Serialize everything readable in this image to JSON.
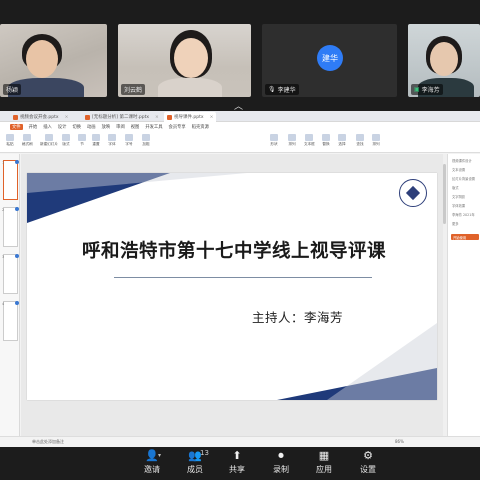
{
  "participants": [
    {
      "name": "杨颖",
      "has_mic": false
    },
    {
      "name": "刘云鹤",
      "has_mic": false
    },
    {
      "name": "李建华",
      "has_mic": true,
      "avatar_text": "建华",
      "avatar_color": "#2f7cf6"
    },
    {
      "name": "李海芳",
      "has_mic": true
    }
  ],
  "collapse_icon": "chevron-up-icon",
  "wps": {
    "tabs": [
      {
        "label": "视频会议开会.pptx"
      },
      {
        "label": "[无标题分析] 第二课时.pptx"
      },
      {
        "label": "视导课件.pptx"
      }
    ],
    "menu": [
      "文件",
      "开始",
      "插入",
      "设计",
      "切换",
      "动画",
      "放映",
      "审阅",
      "视图",
      "开发工具",
      "会员专享",
      "稻壳资源"
    ],
    "ribbon": [
      "粘贴",
      "格式刷",
      "新建幻灯片",
      "版式",
      "节",
      "重置",
      "字体",
      "字号",
      "加粗",
      "形状",
      "排列",
      "文本框",
      "替换",
      "选择",
      "查找",
      "排列"
    ],
    "right_panel": [
      "视频课件设计",
      "文本设置",
      "幻灯片背景设置",
      "版式",
      "文字阴影",
      "字体效果",
      "李海芳 2021年",
      "更多"
    ],
    "right_panel_button": "开始使用",
    "status_note": "单击此处添加备注",
    "zoom": "86%",
    "slide_count": 4
  },
  "slide": {
    "title": "呼和浩特市第十七中学线上视导评课",
    "host": "主持人：李海芳",
    "accent_color": "#1f3a7a"
  },
  "toolbar": [
    {
      "label": "邀请",
      "icon": "invite-icon",
      "glyph": "👤"
    },
    {
      "label": "成员",
      "icon": "members-icon",
      "glyph": "👥",
      "count": "13"
    },
    {
      "label": "共享",
      "icon": "share-icon",
      "glyph": "⬆"
    },
    {
      "label": "录制",
      "icon": "record-icon",
      "glyph": "⏺"
    },
    {
      "label": "应用",
      "icon": "apps-icon",
      "glyph": "▦"
    },
    {
      "label": "设置",
      "icon": "settings-icon",
      "glyph": "⚙"
    }
  ]
}
